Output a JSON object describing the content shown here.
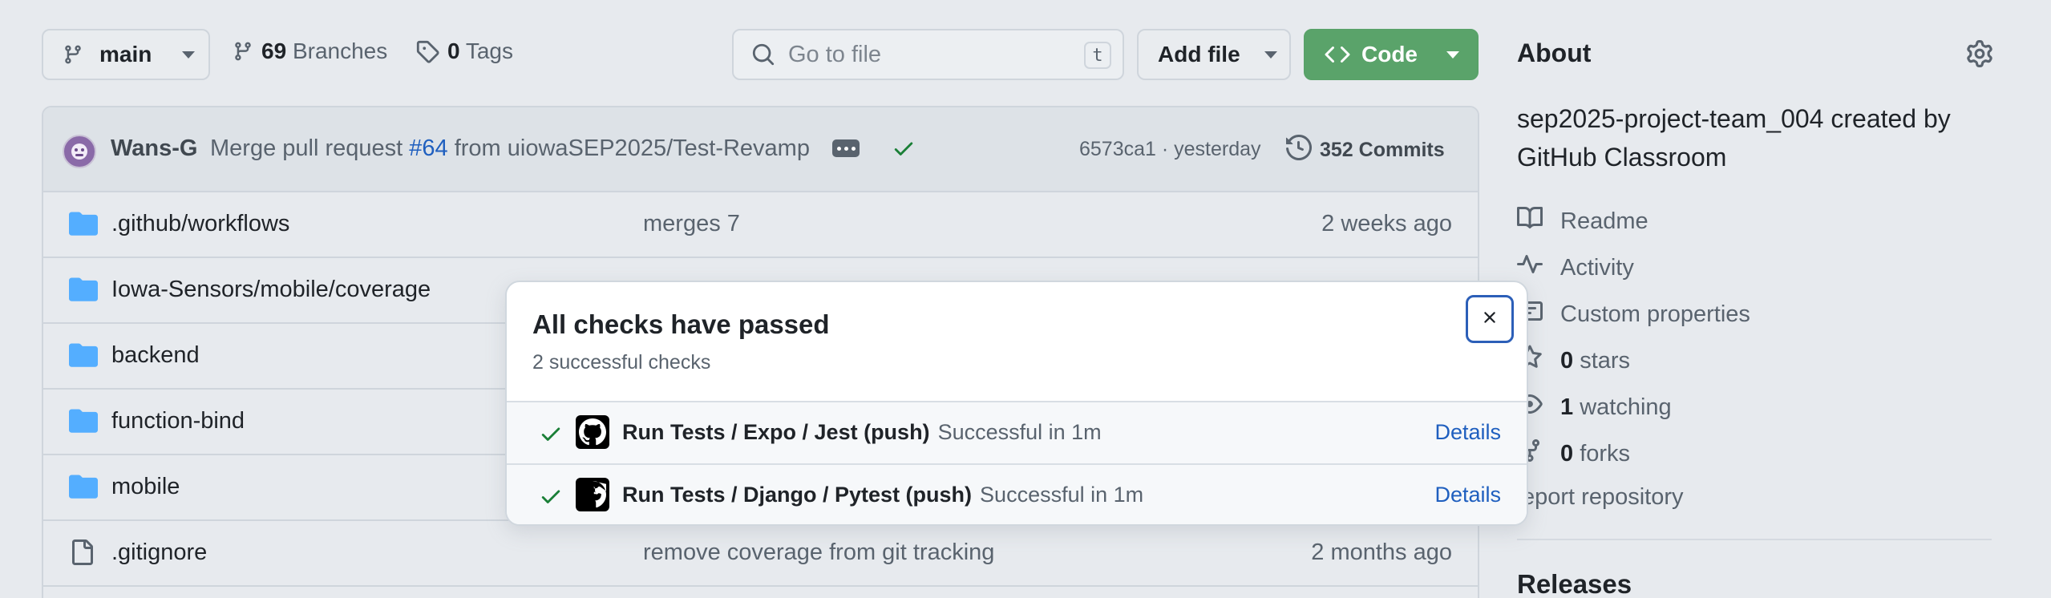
{
  "toolbar": {
    "branch_label": "main",
    "branches_count": "69",
    "branches_label": "Branches",
    "tags_count": "0",
    "tags_label": "Tags",
    "search_placeholder": "Go to file",
    "search_shortcut": "t",
    "add_file_label": "Add file",
    "code_label": "Code"
  },
  "commit": {
    "author": "Wans-G",
    "message_prefix": "Merge pull request",
    "pr_number": "#64",
    "message_suffix": "from uiowaSEP2025/Test-Revamp",
    "sha_time": "6573ca1 · yesterday",
    "commits_count": "352 Commits"
  },
  "files": [
    {
      "name": ".github/workflows",
      "message": "merges 7",
      "date": "2 weeks ago",
      "type": "folder"
    },
    {
      "name": "Iowa-Sensors/mobile/coverage",
      "message": "",
      "date": "",
      "type": "folder"
    },
    {
      "name": "backend",
      "message": "",
      "date": "",
      "type": "folder"
    },
    {
      "name": "function-bind",
      "message": "",
      "date": "",
      "type": "folder"
    },
    {
      "name": "mobile",
      "message": "",
      "date": "",
      "type": "folder"
    },
    {
      "name": ".gitignore",
      "message": "remove coverage from git tracking",
      "date": "2 months ago",
      "type": "file"
    }
  ],
  "about": {
    "title": "About",
    "description": "sep2025-project-team_004 created by GitHub Classroom",
    "readme": "Readme",
    "activity": "Activity",
    "custom_properties": "Custom properties",
    "stars_count": "0",
    "stars_label": "stars",
    "watching_count": "1",
    "watching_label": "watching",
    "forks_count": "0",
    "forks_label": "forks",
    "report": "eport repository",
    "releases_title": "Releases"
  },
  "checks_popover": {
    "title": "All checks have passed",
    "subtitle": "2 successful checks",
    "checks": [
      {
        "name": "Run Tests / Expo / Jest (push)",
        "status": "Successful in 1m",
        "details": "Details"
      },
      {
        "name": "Run Tests / Django / Pytest (push)",
        "status": "Successful in 1m",
        "details": "Details"
      }
    ]
  },
  "colors": {
    "accent_green": "#5aa36a",
    "check_green": "#1a7f37",
    "link_blue": "#1f5fbf",
    "folder_blue": "#54aeff"
  }
}
